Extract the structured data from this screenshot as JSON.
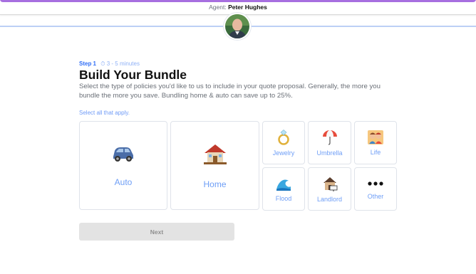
{
  "agent": {
    "prefix": "Agent:",
    "name": "Peter Hughes"
  },
  "step": {
    "label": "Step 1",
    "time": "3 - 5 minutes"
  },
  "title": "Build Your Bundle",
  "description": "Select the type of policies you'd like to us to include in your quote proposal. Generally, the more you bundle the more you save. Bundling home & auto can save up to 25%.",
  "select_hint": "Select all that apply.",
  "options": {
    "auto": "Auto",
    "home": "Home",
    "jewelry": "Jewelry",
    "umbrella": "Umbrella",
    "life": "Life",
    "flood": "Flood",
    "landlord": "Landlord",
    "other": "Other"
  },
  "next_label": "Next",
  "colors": {
    "accent": "#2f6df6",
    "label": "#6e9ef6",
    "border": "#dfe3ea",
    "button_disabled": "#e3e3e3"
  }
}
